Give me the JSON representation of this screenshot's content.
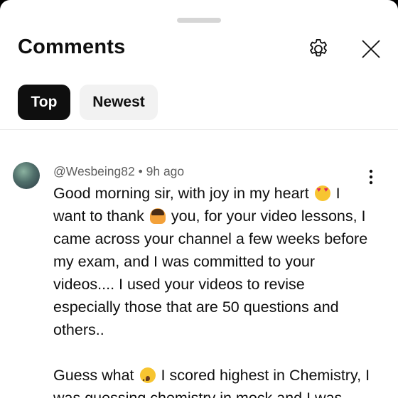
{
  "header": {
    "title": "Comments",
    "settings_icon": "gear-icon",
    "close_icon": "close-icon"
  },
  "tabs": [
    {
      "label": "Top",
      "selected": true
    },
    {
      "label": "Newest",
      "selected": false
    }
  ],
  "comment": {
    "author": "@Wesbeing82",
    "separator": "•",
    "time": "9h ago",
    "menu_icon": "more-vertical-icon",
    "para1_part1": "Good morning sir, with joy in my heart",
    "emoji1": "heart-eyes-emoji",
    "para1_part2": "I want to thank",
    "emoji2": "bowing-person-emoji",
    "para1_part3": "you, for your video lessons, I came across your channel a few weeks before my exam, and I was committed to your videos.... I used your videos to revise especially those that are 50 questions and others..",
    "para2_part1": "Guess what",
    "emoji3": "surprised-face-emoji",
    "para2_part2": "I scored highest in Chemistry, I was guessing chemistry in mock and I was"
  },
  "colors": {
    "selected_chip_bg": "#0f0f0f",
    "chip_bg": "#f2f2f2",
    "meta_text": "#606060",
    "primary_text": "#0f0f0f"
  }
}
